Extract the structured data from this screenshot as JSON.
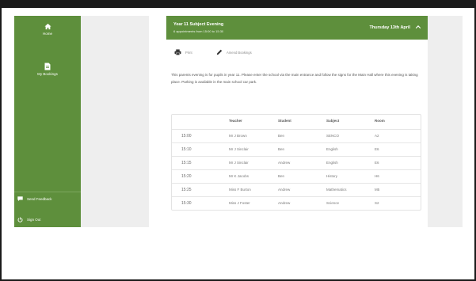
{
  "sidebar": {
    "items": [
      {
        "label": "Home",
        "icon": "home-icon"
      },
      {
        "label": "My Bookings",
        "icon": "document-icon"
      }
    ],
    "footer": [
      {
        "label": "Send Feedback",
        "icon": "feedback-icon"
      },
      {
        "label": "Sign Out",
        "icon": "power-icon"
      }
    ]
  },
  "event": {
    "title": "Year 11 Subject Evening",
    "subtitle": "6 appointments from 15:00 to 15:30",
    "date": "Thursday 13th April"
  },
  "toolbar": {
    "print_label": "Print",
    "amend_label": "Amend Bookings"
  },
  "intro_text": "This parents evening is for pupils in year 11. Please enter the school via the main entrance and follow the signs for the Main Hall where this evening is taking place. Parking is available in the main school car park.",
  "table": {
    "headers": [
      "Teacher",
      "Student",
      "Subject",
      "Room"
    ],
    "rows": [
      {
        "time": "15:00",
        "teacher": "Mr J Brown",
        "student": "Ben",
        "subject": "SENCO",
        "room": "A2"
      },
      {
        "time": "15:10",
        "teacher": "Mr J Sinclair",
        "student": "Ben",
        "subject": "English",
        "room": "E6"
      },
      {
        "time": "15:15",
        "teacher": "Mr J Sinclair",
        "student": "Andrew",
        "subject": "English",
        "room": "E6"
      },
      {
        "time": "15:20",
        "teacher": "Mr K Jacobs",
        "student": "Ben",
        "subject": "History",
        "room": "H6"
      },
      {
        "time": "15:25",
        "teacher": "Miss F Burton",
        "student": "Andrew",
        "subject": "Mathematics",
        "room": "M5"
      },
      {
        "time": "15:30",
        "teacher": "Miss J Foster",
        "student": "Andrew",
        "subject": "Science",
        "room": "S2"
      }
    ]
  },
  "colors": {
    "brand_green": "#5e8f3c",
    "panel_grey": "#eeeeee",
    "frame_border": "#1b1b1b"
  }
}
